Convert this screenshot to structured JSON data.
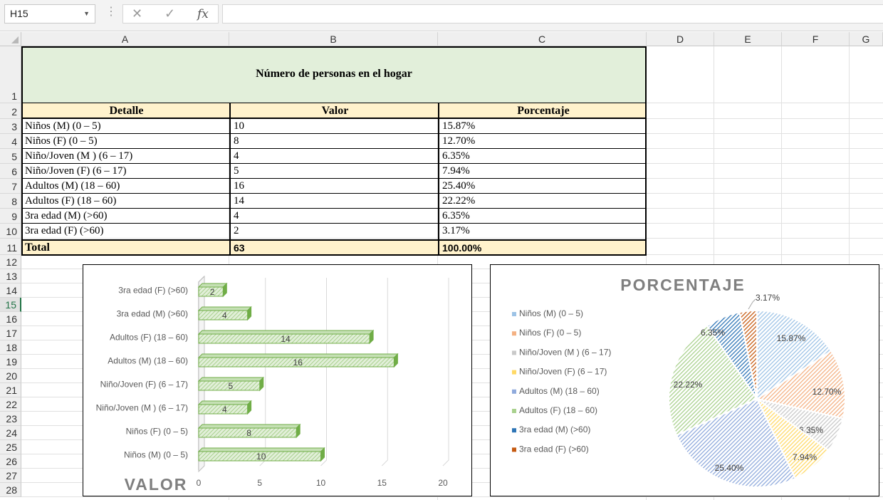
{
  "formula_bar": {
    "name_box": "H15",
    "cancel_icon": "✕",
    "enter_icon": "✓",
    "fx_label": "fx",
    "formula": ""
  },
  "columns": [
    "A",
    "B",
    "C",
    "D",
    "E",
    "F",
    "G"
  ],
  "rows": [
    "1",
    "2",
    "3",
    "4",
    "5",
    "6",
    "7",
    "8",
    "9",
    "10",
    "11",
    "12",
    "13",
    "14",
    "15",
    "16",
    "17",
    "18",
    "19",
    "20",
    "21",
    "22",
    "23",
    "24",
    "25",
    "26",
    "27",
    "28"
  ],
  "selected_row": "15",
  "table": {
    "title": "Número de personas en el hogar",
    "headers": [
      "Detalle",
      "Valor",
      "Porcentaje"
    ],
    "rows": [
      [
        "Niños (M) (0 – 5)",
        "10",
        "15.87%"
      ],
      [
        "Niños (F) (0 – 5)",
        "8",
        "12.70%"
      ],
      [
        "Niño/Joven (M ) (6 – 17)",
        "4",
        "6.35%"
      ],
      [
        "Niño/Joven (F) (6 – 17)",
        "5",
        "7.94%"
      ],
      [
        "Adultos (M) (18 – 60)",
        "16",
        "25.40%"
      ],
      [
        "Adultos (F) (18 – 60)",
        "14",
        "22.22%"
      ],
      [
        "3ra edad (M) (>60)",
        "4",
        "6.35%"
      ],
      [
        "3ra edad (F) (>60)",
        "2",
        "3.17%"
      ]
    ],
    "total": [
      "Total",
      "63",
      "100.00%"
    ]
  },
  "colors": {
    "title_fill": "#e2efda",
    "header_fill": "#fff2cc",
    "bar_fill": "#a9d18e",
    "bar_edge": "#70ad47",
    "pie": [
      "#9dc3e6",
      "#f4b183",
      "#c9c9c9",
      "#ffd966",
      "#8faadc",
      "#a9d18e",
      "#2e75b6",
      "#c55a11"
    ]
  },
  "chart_data": [
    {
      "type": "bar",
      "orientation": "horizontal",
      "title": "VALOR",
      "categories": [
        "Niños (M) (0 – 5)",
        "Niños (F) (0 – 5)",
        "Niño/Joven (M ) (6 – 17)",
        "Niño/Joven (F) (6 – 17)",
        "Adultos (M) (18 – 60)",
        "Adultos (F) (18 – 60)",
        "3ra edad (M) (>60)",
        "3ra edad (F) (>60)"
      ],
      "values": [
        10,
        8,
        4,
        5,
        16,
        14,
        4,
        2
      ],
      "xlim": [
        0,
        20
      ],
      "xticks": [
        "0",
        "5",
        "10",
        "15",
        "20"
      ],
      "grid": true
    },
    {
      "type": "pie",
      "title": "PORCENTAJE",
      "labels": [
        "Niños (M) (0 – 5)",
        "Niños (F) (0 – 5)",
        "Niño/Joven (M ) (6 – 17)",
        "Niño/Joven (F) (6 – 17)",
        "Adultos (M) (18 – 60)",
        "Adultos (F) (18 – 60)",
        "3ra edad (M) (>60)",
        "3ra edad (F) (>60)"
      ],
      "values": [
        15.87,
        12.7,
        6.35,
        7.94,
        25.4,
        22.22,
        6.35,
        3.17
      ],
      "value_labels": [
        "15.87%",
        "12.70%",
        "6.35%",
        "7.94%",
        "25.40%",
        "22.22%",
        "6.35%",
        "3.17%"
      ],
      "legend": "left"
    }
  ]
}
